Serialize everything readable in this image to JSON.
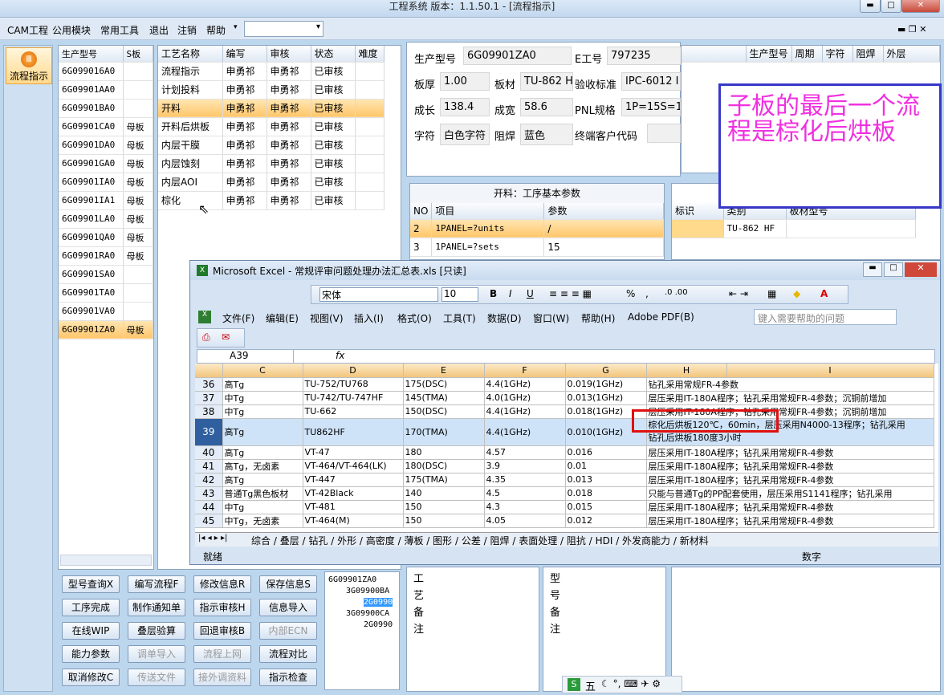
{
  "app": {
    "title": "工程系统   版本：1.1.50.1 - [流程指示]"
  },
  "menu": [
    "CAM工程",
    "公用模块",
    "常用工具",
    "退出",
    "注销",
    "帮助"
  ],
  "left_toolbar": {
    "flow_button": "流程指示"
  },
  "model_list": {
    "headers": [
      "生产型号",
      "S板"
    ],
    "rows": [
      [
        "6G099016A0",
        ""
      ],
      [
        "6G09901AA0",
        ""
      ],
      [
        "6G09901BA0",
        ""
      ],
      [
        "6G09901CA0",
        "母板"
      ],
      [
        "6G09901DA0",
        "母板"
      ],
      [
        "6G09901GA0",
        "母板"
      ],
      [
        "6G09901IA0",
        "母板"
      ],
      [
        "6G09901IA1",
        "母板"
      ],
      [
        "6G09901LA0",
        "母板"
      ],
      [
        "6G09901QA0",
        "母板"
      ],
      [
        "6G09901RA0",
        "母板"
      ],
      [
        "6G09901SA0",
        ""
      ],
      [
        "6G09901TA0",
        ""
      ],
      [
        "6G09901VA0",
        ""
      ],
      [
        "6G09901ZA0",
        "母板"
      ]
    ],
    "selected_index": 14
  },
  "process_list": {
    "headers": [
      "工艺名称",
      "编写",
      "审核",
      "状态",
      "难度"
    ],
    "rows": [
      [
        "流程指示",
        "申勇祁",
        "申勇祁",
        "已审核",
        ""
      ],
      [
        "计划投料",
        "申勇祁",
        "申勇祁",
        "已审核",
        ""
      ],
      [
        "开料",
        "申勇祁",
        "申勇祁",
        "已审核",
        ""
      ],
      [
        "开料后烘板",
        "申勇祁",
        "申勇祁",
        "已审核",
        ""
      ],
      [
        "内层干膜",
        "申勇祁",
        "申勇祁",
        "已审核",
        ""
      ],
      [
        "内层蚀刻",
        "申勇祁",
        "申勇祁",
        "已审核",
        ""
      ],
      [
        "内层AOI",
        "申勇祁",
        "申勇祁",
        "已审核",
        ""
      ],
      [
        "棕化",
        "申勇祁",
        "申勇祁",
        "已审核",
        ""
      ]
    ],
    "selected_index": 2
  },
  "info": {
    "prod_label": "生产型号",
    "prod_value": "6G09901ZA0",
    "e_label": "E工号",
    "e_value": "797235",
    "thick_label": "板厚",
    "thick_value": "1.00",
    "mat_label": "板材",
    "mat_value": "TU-862 H",
    "std_label": "验收标准",
    "std_value": "IPC-6012 I",
    "len_label": "成长",
    "len_value": "138.4",
    "wid_label": "成宽",
    "wid_value": "58.6",
    "pnl_label": "PNL规格",
    "pnl_value": "1P=15S=1",
    "char_label": "字符",
    "char_value": "白色字符",
    "mask_label": "阻焊",
    "mask_value": "蓝色",
    "cust_label": "终端客户代码",
    "cust_value": ""
  },
  "right_grid_headers": [
    "生产型号",
    "周期",
    "字符",
    "阻焊",
    "外层"
  ],
  "param_panel": {
    "title": "开料：工序基本参数",
    "headers": [
      "NO",
      "项目",
      "参数"
    ],
    "rows": [
      [
        "2",
        "1PANEL=?units",
        "/"
      ],
      [
        "3",
        "1PANEL=?sets",
        "15"
      ]
    ]
  },
  "material_panel": {
    "headers": [
      "标识",
      "类别",
      "板材型号"
    ],
    "rows": [
      [
        "",
        "TU-862 HF",
        ""
      ]
    ]
  },
  "note": "子板的最后一个流程是棕化后烘板",
  "bottom_buttons": [
    [
      "型号查询X",
      "编写流程F",
      "修改信息R",
      "保存信息S"
    ],
    [
      "工序完成",
      "制作通知单",
      "指示审核H",
      "信息导入"
    ],
    [
      "在线WIP",
      "叠层验算",
      "回退审核B",
      "内部ECN"
    ],
    [
      "能力参数",
      "调单导入",
      "流程上网",
      "流程对比"
    ],
    [
      "取消修改C",
      "传送文件",
      "接外调资料",
      "指示检查"
    ]
  ],
  "disabled_buttons": [
    "内部ECN",
    "调单导入",
    "流程上网",
    "传送文件",
    "接外调资料"
  ],
  "tree": [
    "6G09901ZA0",
    "3G09900BA",
    "2G0990",
    "3G09900CA",
    "2G0990"
  ],
  "remarks": {
    "process": "工艺备注",
    "model": "型号备注"
  },
  "excel": {
    "title": "Microsoft Excel - 常规评审问题处理办法汇总表.xls  [只读]",
    "font": "宋体",
    "size": "10",
    "menu": [
      "文件(F)",
      "编辑(E)",
      "视图(V)",
      "插入(I)",
      "格式(O)",
      "工具(T)",
      "数据(D)",
      "窗口(W)",
      "帮助(H)",
      "Adobe PDF(B)"
    ],
    "help_placeholder": "键入需要帮助的问题",
    "namebox": "A39",
    "columns": [
      "C",
      "D",
      "E",
      "F",
      "G",
      "H",
      "I"
    ],
    "rows": [
      [
        "36",
        "高Tg",
        "TU-752/TU768",
        "175(DSC)",
        "4.4(1GHz)",
        "0.019(1GHz)",
        "钻孔采用常规FR-4参数"
      ],
      [
        "37",
        "中Tg",
        "TU-742/TU-747HF",
        "145(TMA)",
        "4.0(1GHz)",
        "0.013(1GHz)",
        "层压采用IT-180A程序；钻孔采用常规FR-4参数；沉铜前增加"
      ],
      [
        "38",
        "中Tg",
        "TU-662",
        "150(DSC)",
        "4.4(1GHz)",
        "0.018(1GHz)",
        "层压采用IT-180A程序；钻孔采用常规FR-4参数；沉铜前增加"
      ],
      [
        "39",
        "高Tg",
        "TU862HF",
        "170(TMA)",
        "4.4(1GHz)",
        "0.010(1GHz)",
        "棕化后烘板120℃，60min，层压采用N4000-13程序；钻孔采用"
      ],
      [
        "40",
        "高Tg",
        "VT-47",
        "180",
        "4.57",
        "0.016",
        "层压采用IT-180A程序；钻孔采用常规FR-4参数"
      ],
      [
        "41",
        "高Tg，无卤素",
        "VT-464/VT-464(LK)",
        "180(DSC)",
        "3.9",
        "0.01",
        "层压采用IT-180A程序；钻孔采用常规FR-4参数"
      ],
      [
        "42",
        "高Tg",
        "VT-447",
        "175(TMA)",
        "4.35",
        "0.013",
        "层压采用IT-180A程序；钻孔采用常规FR-4参数"
      ],
      [
        "43",
        "普通Tg黑色板材",
        "VT-42Black",
        "140",
        "4.5",
        "0.018",
        "只能与普通Tg的PP配套使用，层压采用S1141程序；钻孔采用"
      ],
      [
        "44",
        "中Tg",
        "VT-481",
        "150",
        "4.3",
        "0.015",
        "层压采用IT-180A程序；钻孔采用常规FR-4参数"
      ],
      [
        "45",
        "中Tg，无卤素",
        "VT-464(M)",
        "150",
        "4.05",
        "0.012",
        "层压采用IT-180A程序；钻孔采用常规FR-4参数"
      ]
    ],
    "row39_extra": "钻孔后烘板180度3小时",
    "sheet_tabs": [
      "综合",
      "叠层",
      "钻孔",
      "外形",
      "高密度",
      "薄板",
      "图形",
      "公差",
      "阻焊",
      "表面处理",
      "阻抗",
      "HDI",
      "外发商能力",
      "新材料"
    ],
    "status": "就绪",
    "status_right": "数字"
  },
  "ime": "五"
}
